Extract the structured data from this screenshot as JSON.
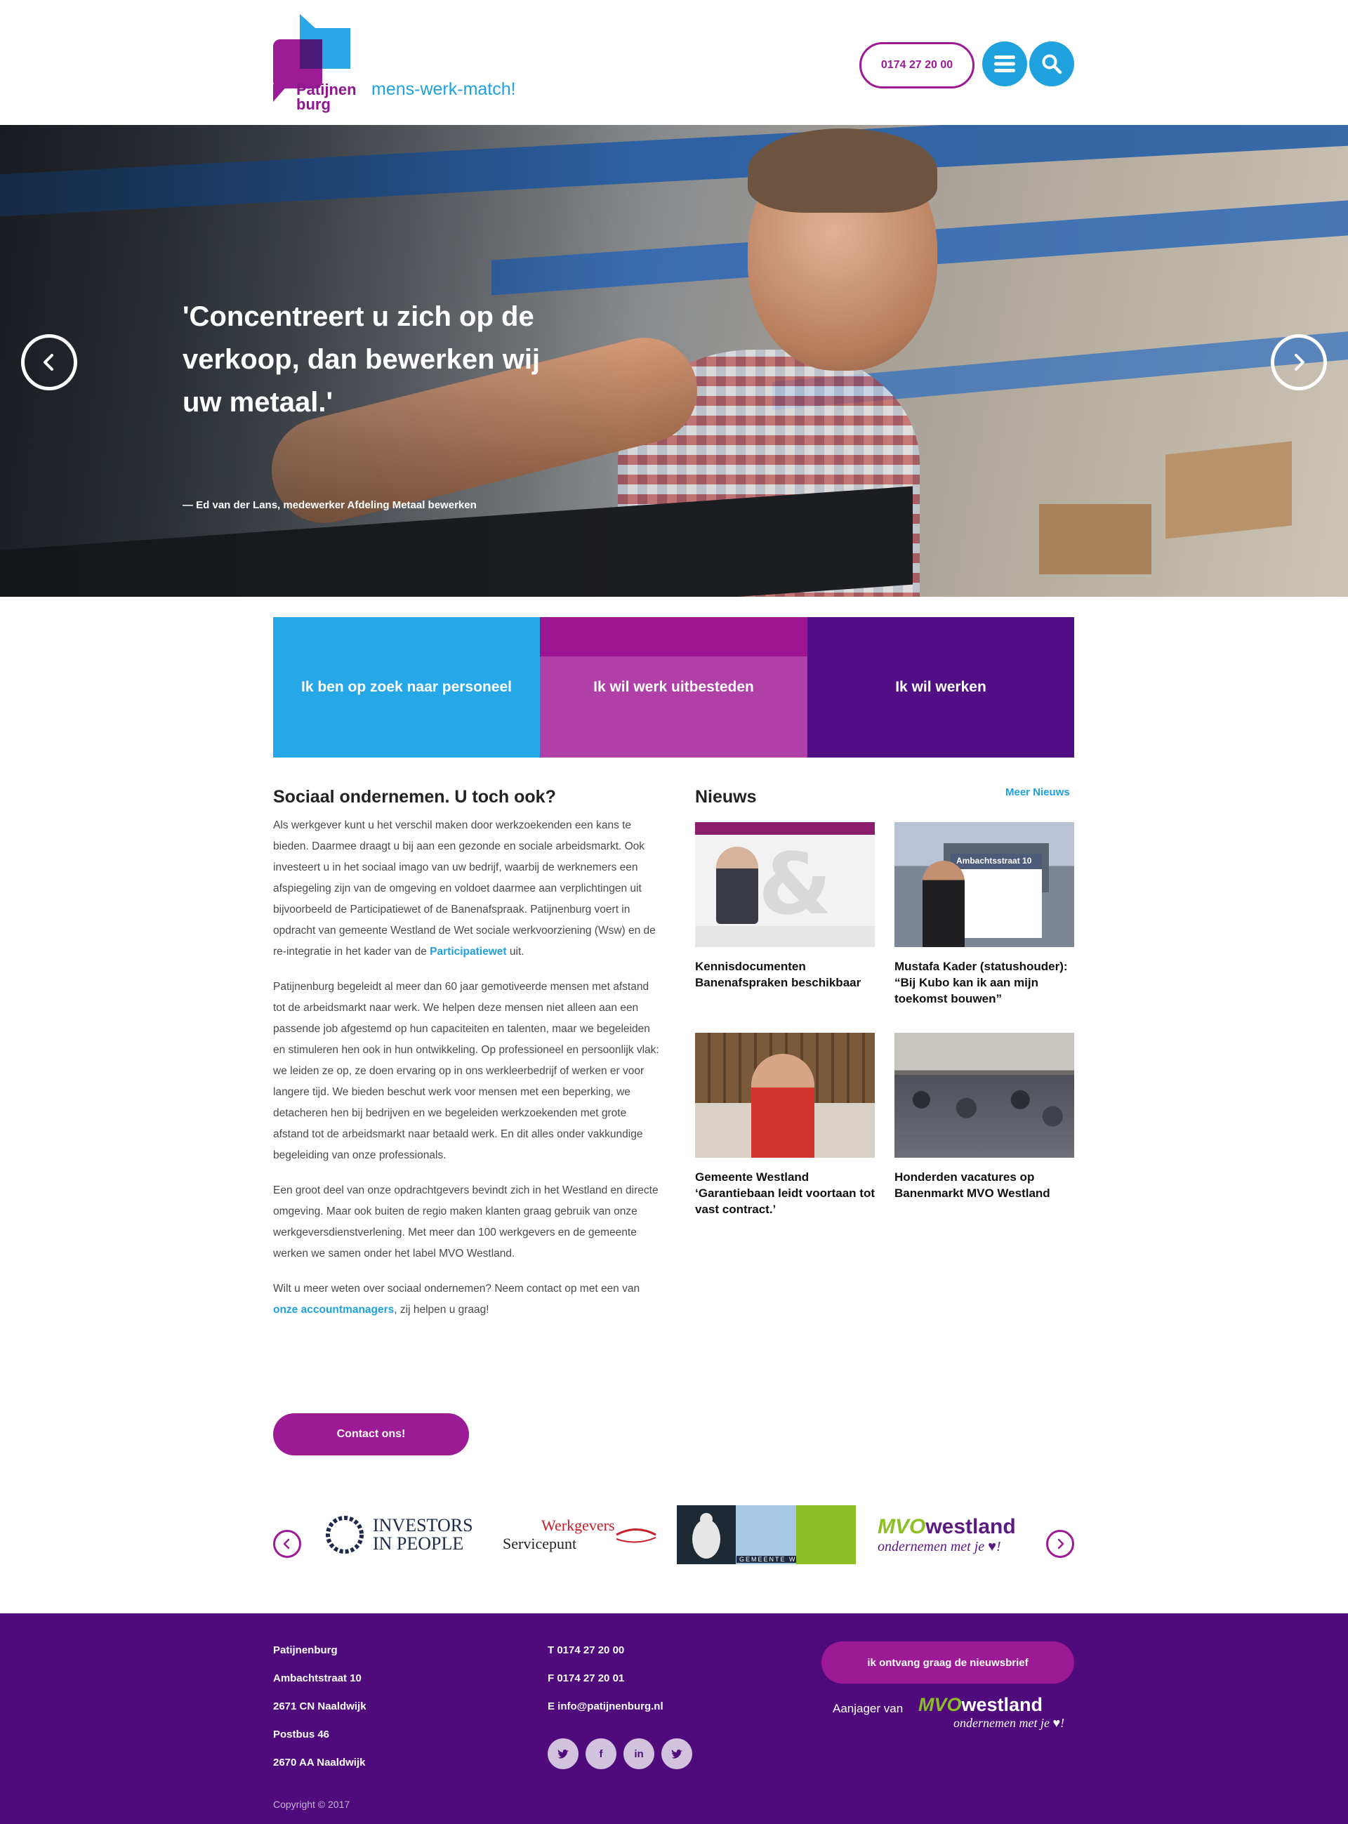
{
  "header": {
    "logo_word_line1": "Patijnen",
    "logo_word_line2": "burg",
    "tagline": "mens-werk-match!",
    "phone": "0174 27 20 00",
    "menu_icon": "menu-icon",
    "search_icon": "search-icon"
  },
  "hero": {
    "quote": "'Concentreert u zich op de verkoop, dan bewerken wij uw metaal.'",
    "author": "— Ed van der Lans, medewerker Afdeling Metaal bewerken",
    "prev_icon": "chevron-left-icon",
    "next_icon": "chevron-right-icon"
  },
  "tiles": [
    {
      "label": "Ik ben op zoek naar personeel",
      "color": "#26a7e8"
    },
    {
      "label": "Ik wil werk uitbesteden",
      "color": "#b03fa8"
    },
    {
      "label": "Ik wil werken",
      "color": "#520f85"
    }
  ],
  "about": {
    "title": "Sociaal ondernemen. U toch ook?",
    "p1": "Als werkgever kunt u het verschil maken door werkzoekenden een kans te bieden. Daarmee draagt u bij aan een gezonde en sociale arbeidsmarkt. Ook investeert u in het sociaal imago van uw bedrijf, waarbij de werknemers een afspiegeling zijn van de omgeving en voldoet daarmee aan verplichtingen uit bijvoorbeeld de Participatiewet of de Banenafspraak. Patijnenburg voert in opdracht van gemeente Westland de Wet sociale werkvoorziening (Wsw) en de re-integratie in het kader van de",
    "p1_link": "Participatiewet",
    "p1_end": " uit.",
    "p2": "Patijnenburg begeleidt al meer dan 60 jaar gemotiveerde mensen met afstand tot de arbeidsmarkt naar werk. We helpen deze mensen niet alleen aan een passende job afgestemd op hun capaciteiten en talenten, maar we begeleiden en stimuleren hen ook in hun ontwikkeling. Op professioneel en persoonlijk vlak: we leiden ze op, ze doen ervaring op in ons werkleerbedrijf of werken er voor langere tijd. We bieden beschut werk voor mensen met een beperking, we detacheren hen bij bedrijven en we begeleiden werkzoekenden met grote afstand tot de arbeidsmarkt naar betaald werk. En dit alles onder vakkundige begeleiding van onze professionals.",
    "p3": "Een groot deel van onze opdrachtgevers bevindt zich in het Westland en directe omgeving. Maar ook buiten de regio maken klanten graag gebruik van onze werkgeversdienstverlening. Met meer dan 100 werkgevers en de gemeente werken we samen onder het label MVO Westland.",
    "p4": "Wilt u meer weten over sociaal ondernemen? Neem contact op met een van ",
    "p4_link": "onze accountmanagers",
    "p4_end": ", zij helpen u graag!",
    "contact_button": "Contact ons!"
  },
  "news": {
    "title": "Nieuws",
    "more": "Meer Nieuws",
    "items": [
      {
        "caption": "Kennisdocumenten Banenafspraken beschikbaar"
      },
      {
        "caption": "Mustafa Kader (statushouder): “Bij Kubo kan ik aan mijn toekomst bouwen”",
        "sign_text": "Ambachtsstraat 10"
      },
      {
        "caption": "Gemeente Westland ‘Garantiebaan leidt voortaan tot vast contract.’"
      },
      {
        "caption": "Honderden vacatures op Banenmarkt MVO Westland"
      }
    ]
  },
  "partners": {
    "iip_line1": "INVESTORS",
    "iip_line2": "IN PEOPLE",
    "wsp_line1": "Werkgevers",
    "wsp_line2": "Servicepunt",
    "gw_label": "GEMEENTE WESTLAND",
    "mvo_a": "MVO",
    "mvo_b": "westland",
    "mvo_sub": "ondernemen met je ♥!",
    "prev_icon": "chevron-left-icon",
    "next_icon": "chevron-right-icon"
  },
  "footer": {
    "address": [
      "Patijnenburg",
      "Ambachtstraat 10",
      "2671 CN Naaldwijk",
      "Postbus 46",
      "2670 AA Naaldwijk"
    ],
    "contact": [
      "T 0174 27 20 00",
      "F 0174 27 20 01",
      "E info@patijnenburg.nl"
    ],
    "socials": [
      {
        "icon": "twitter-icon",
        "glyph": "🐦"
      },
      {
        "icon": "facebook-icon",
        "glyph": "f"
      },
      {
        "icon": "linkedin-icon",
        "glyph": "in"
      },
      {
        "icon": "twitter-icon",
        "glyph": "🐦"
      }
    ],
    "newsletter": "ik ontvang graag de nieuwsbrief",
    "aanjager": "Aanjager van",
    "copyright": "Copyright © 2017"
  }
}
